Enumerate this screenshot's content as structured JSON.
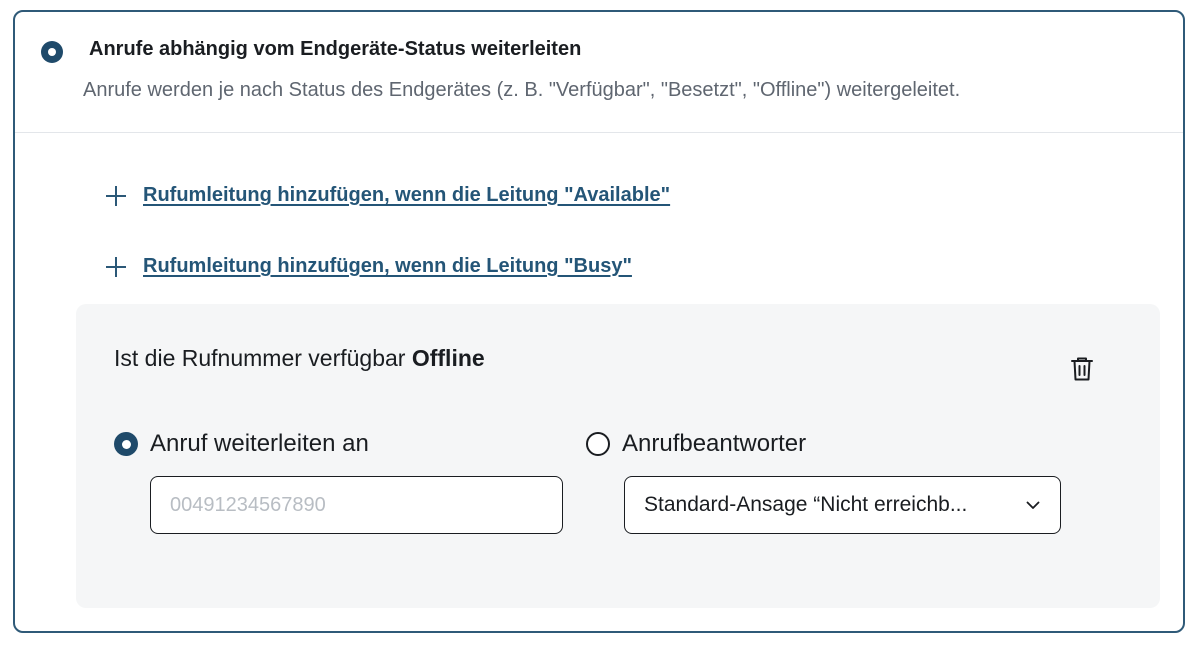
{
  "section": {
    "title": "Anrufe abhängig vom Endgeräte-Status weiterleiten",
    "description": "Anrufe werden je nach Status des Endgerätes (z. B. \"Verfügbar\", \"Besetzt\", \"Offline\") weitergeleitet.",
    "selected": true
  },
  "add_links": [
    {
      "label": "Rufumleitung hinzufügen, wenn die Leitung \"Available\"",
      "icon": "plus-icon"
    },
    {
      "label": "Rufumleitung hinzufügen, wenn die Leitung \"Busy\"",
      "icon": "plus-icon"
    }
  ],
  "rule": {
    "title_prefix": "Ist die Rufnummer verfügbar",
    "title_status": "Offline",
    "delete_icon": "trash-icon",
    "options": [
      {
        "label": "Anruf weiterleiten an",
        "selected": true
      },
      {
        "label": "Anrufbeantworter",
        "selected": false
      }
    ],
    "forward_input": {
      "value": "",
      "placeholder": "00491234567890"
    },
    "voicemail_select": {
      "value": "Standard-Ansage “Nicht erreichb...",
      "icon": "chevron-down-icon"
    }
  },
  "colors": {
    "accent": "#1f4a6a",
    "link": "#245577",
    "border": "#2f5a78",
    "panel_bg": "#f5f6f7"
  }
}
